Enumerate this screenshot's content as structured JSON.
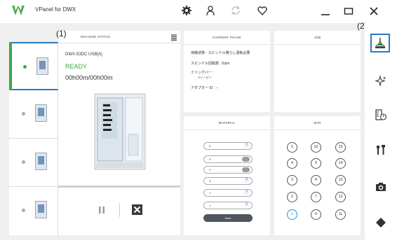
{
  "app": {
    "title": "VPanel for DWX",
    "logo_color": "#4caf50"
  },
  "titlebar": {
    "icons": [
      "gear-icon",
      "user-icon",
      "sync-icon",
      "heart-icon"
    ],
    "window_controls": [
      "minimize-icon",
      "maximize-icon",
      "close-icon"
    ]
  },
  "callouts": {
    "c1": "(1)",
    "c2": "(2)"
  },
  "machines": [
    {
      "status_color": "#3aa84b",
      "active": true
    },
    {
      "status_color": "#aaaaaa",
      "active": false
    },
    {
      "status_color": "#aaaaaa",
      "active": false
    },
    {
      "status_color": "#aaaaaa",
      "active": false
    }
  ],
  "machine_status": {
    "title": "MACHINE STATUS",
    "model": "DWX-53DC USB[A]",
    "state": "READY",
    "time": "00h00m/00h00m"
  },
  "current_phase": {
    "title": "CURRENT PHASE",
    "lines": [
      "待機状態 - スピンドル慣らし運転必要",
      "スピンドル回転数 : 0rpm",
      "ミリングバー :",
      "アダプター ID : --"
    ],
    "sub": "ディーピン"
  },
  "job": {
    "title": "JOB"
  },
  "material": {
    "title": "MATERIAL",
    "slots": [
      {
        "num": "6",
        "state": "?"
      },
      {
        "num": "5",
        "state": "pill"
      },
      {
        "num": "4",
        "state": "pill"
      },
      {
        "num": "3",
        "state": "?"
      },
      {
        "num": "2",
        "state": "?"
      },
      {
        "num": "1",
        "state": "?"
      }
    ],
    "scan_label": "Scan"
  },
  "bur": {
    "title": "BUR",
    "columns": [
      [
        "5",
        "4",
        "3",
        "2",
        "1"
      ],
      [
        "10",
        "9",
        "8",
        "7",
        "6"
      ],
      [
        "15",
        "14",
        "13",
        "12",
        "11"
      ]
    ],
    "selected": "1",
    "selected_color": "#2a8fd0"
  },
  "sidebar": {
    "icons": [
      "milling-icon",
      "sparkle-icon",
      "calibration-icon",
      "tools-icon",
      "camera-icon",
      "diamond-icon"
    ],
    "active": "milling-icon",
    "accent": "#2a7ac0"
  }
}
